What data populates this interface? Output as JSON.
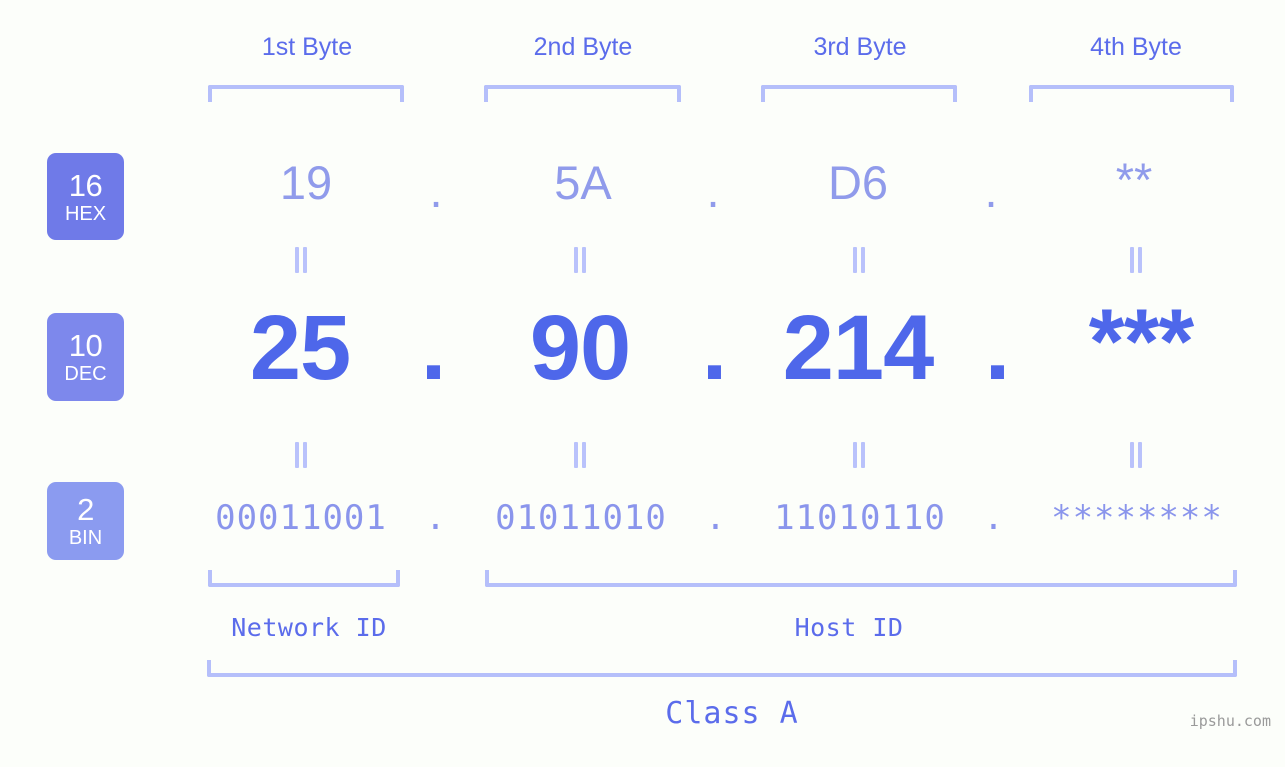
{
  "background_color": "#fcfefa",
  "accent_color": "#5b6ceb",
  "bracket_color": "#b5bffa",
  "byte_headers": [
    {
      "label": "1st Byte"
    },
    {
      "label": "2nd Byte"
    },
    {
      "label": "3rd Byte"
    },
    {
      "label": "4th Byte"
    }
  ],
  "bases": [
    {
      "id": "hex",
      "radix": "16",
      "name": "HEX",
      "color": "#6f7ae8"
    },
    {
      "id": "dec",
      "radix": "10",
      "name": "DEC",
      "color": "#7d88ec"
    },
    {
      "id": "bin",
      "radix": "2",
      "name": "BIN",
      "color": "#8b9bf0"
    }
  ],
  "rows": {
    "hex": {
      "bytes": [
        "19",
        "5A",
        "D6",
        "**"
      ],
      "separators": [
        ".",
        ".",
        "."
      ]
    },
    "dec": {
      "bytes": [
        "25",
        "90",
        "214",
        "***"
      ],
      "separators": [
        ".",
        ".",
        "."
      ]
    },
    "bin": {
      "bytes": [
        "00011001",
        "01011010",
        "11010110",
        "********"
      ],
      "separators": [
        ".",
        ".",
        "."
      ]
    }
  },
  "equality_marker": "=",
  "segments": {
    "network_id": "Network ID",
    "host_id": "Host ID",
    "class": "Class A"
  },
  "watermark": "ipshu.com"
}
